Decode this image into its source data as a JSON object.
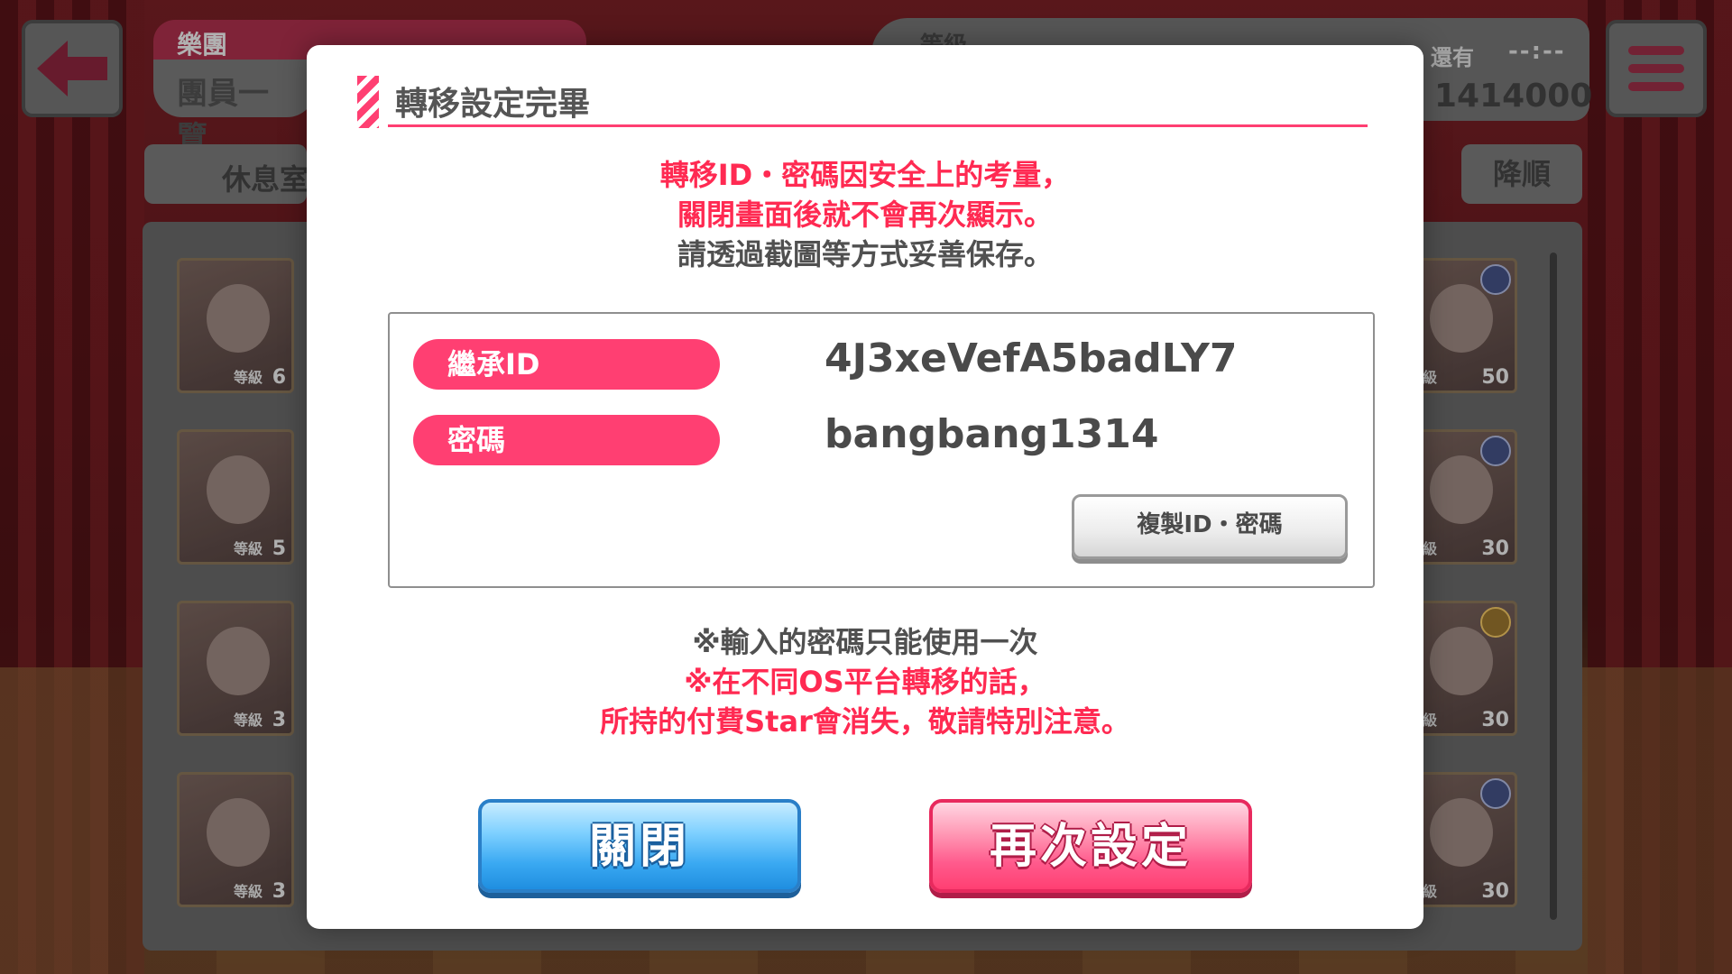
{
  "background": {
    "band_label": "樂團",
    "band_sub": "團員一覽",
    "rest_tab": "休息室",
    "sort_button": "降順",
    "level_label": "等級",
    "remain_label": "還有",
    "remain_time": "--:--",
    "coins": "1414000",
    "cards_left": [
      {
        "lv": "等級",
        "num": "6"
      },
      {
        "lv": "等級",
        "num": "5"
      },
      {
        "lv": "等級",
        "num": "3"
      },
      {
        "lv": "等級",
        "num": "3"
      }
    ],
    "cards_right": [
      {
        "lv": "等級",
        "num": "50"
      },
      {
        "lv": "等級",
        "num": "30"
      },
      {
        "lv": "等級",
        "num": "30"
      },
      {
        "lv": "等級",
        "num": "30"
      }
    ]
  },
  "modal": {
    "title": "轉移設定完畢",
    "notice_red_1": "轉移ID・密碼因安全上的考量，",
    "notice_red_2": "關閉畫面後就不會再次顯示。",
    "notice_grey": "請透過截圖等方式妥善保存。",
    "id_label": "繼承ID",
    "id_value": "4J3xeVefA5badLY7",
    "password_label": "密碼",
    "password_value": "bangbang1314",
    "copy_button": "複製ID・密碼",
    "footnote_grey": "※輸入的密碼只能使用一次",
    "footnote_red_1": "※在不同OS平台轉移的話，",
    "footnote_red_2": "所持的付費Star會消失，敬請特別注意。",
    "close_button": "關閉",
    "reset_button": "再次設定"
  }
}
